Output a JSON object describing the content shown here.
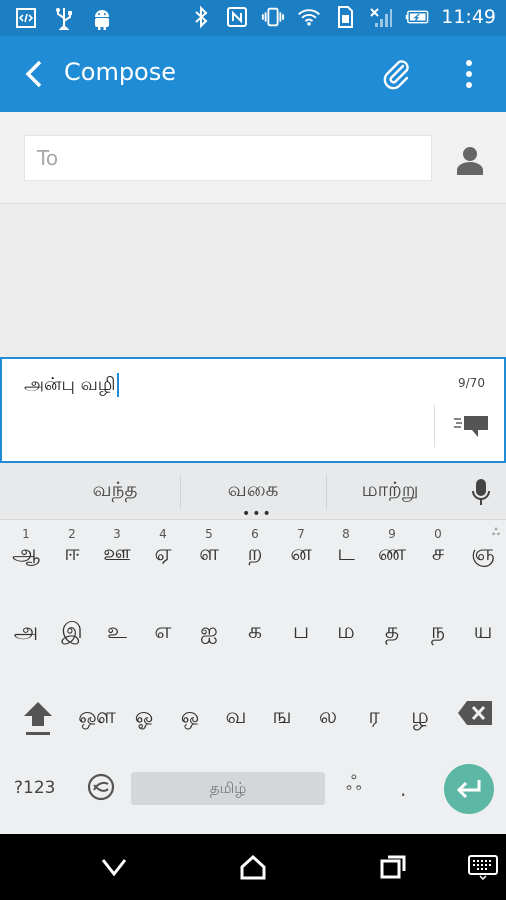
{
  "status_bar": {
    "time": "11:49",
    "left_icons": [
      "developer-icon",
      "usb-icon",
      "android-icon"
    ],
    "right_icons": [
      "bluetooth-icon",
      "nfc-icon",
      "vibrate-icon",
      "wifi-icon",
      "sim-card-icon",
      "no-signal-icon",
      "battery-charging-icon"
    ]
  },
  "app_bar": {
    "title": "Compose",
    "back_icon": "chevron-left-icon",
    "attach_icon": "paperclip-icon",
    "overflow_icon": "more-vertical-icon",
    "background": "#1f8cd5"
  },
  "compose": {
    "to_placeholder": "To",
    "to_value": "",
    "contact_icon": "person-icon",
    "message_text": "அன்பு வழி",
    "char_count": "9/70",
    "send_icon": "send-message-icon"
  },
  "keyboard": {
    "suggestions": [
      "வந்த",
      "வகை",
      "மாற்று"
    ],
    "suggestion_more": "•••",
    "row1": [
      {
        "num": "1",
        "char": "ஆ"
      },
      {
        "num": "2",
        "char": "ஈ"
      },
      {
        "num": "3",
        "char": "ஊ"
      },
      {
        "num": "4",
        "char": "ஏ"
      },
      {
        "num": "5",
        "char": "ள"
      },
      {
        "num": "6",
        "char": "ற"
      },
      {
        "num": "7",
        "char": "ன"
      },
      {
        "num": "8",
        "char": "ட"
      },
      {
        "num": "9",
        "char": "ண"
      },
      {
        "num": "0",
        "char": "ச"
      },
      {
        "num": "ஃ",
        "char": "ஞ"
      }
    ],
    "row2": [
      "அ",
      "இ",
      "உ",
      "எ",
      "ஐ",
      "க",
      "ப",
      "ம",
      "த",
      "ந",
      "ய"
    ],
    "row3": [
      "ஔ",
      "ஓ",
      "ஒ",
      "வ",
      "ங",
      "ல",
      "ர",
      "ழ"
    ],
    "symbols_key": "?123",
    "space_label": "தமிழ்",
    "extra_key_1": "ஃ",
    "period_key": ".",
    "accent": "#5db7a5"
  },
  "nav_bar": {
    "icons": [
      "back-nav-icon",
      "home-icon",
      "recents-icon",
      "keyboard-switch-icon"
    ]
  }
}
